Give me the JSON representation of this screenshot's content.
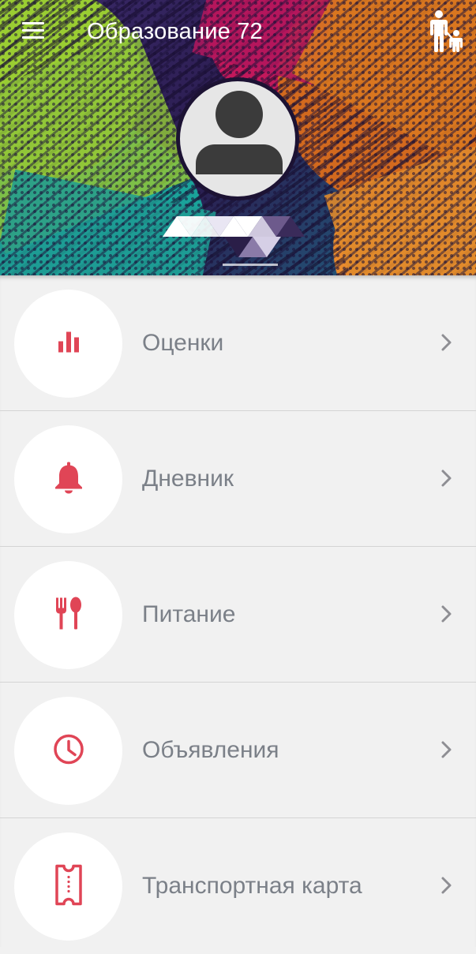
{
  "app": {
    "title": "Образование 72"
  },
  "header": {
    "menu_icon": "hamburger-menu-icon",
    "parent_child_icon": "parent-child-icon",
    "avatar_icon": "user-placeholder-icon",
    "profile_name_obscured": true
  },
  "menu": {
    "items": [
      {
        "label": "Оценки",
        "icon": "bar-chart-icon"
      },
      {
        "label": "Дневник",
        "icon": "bell-icon"
      },
      {
        "label": "Питание",
        "icon": "fork-spoon-icon"
      },
      {
        "label": "Объявления",
        "icon": "clock-icon"
      },
      {
        "label": "Транспортная карта",
        "icon": "ticket-icon"
      }
    ]
  },
  "colors": {
    "accent": "#e04556",
    "label": "#7b8088",
    "chevron": "#8e8e93",
    "background": "#f1f1f1",
    "divider": "#d4d4d4"
  }
}
